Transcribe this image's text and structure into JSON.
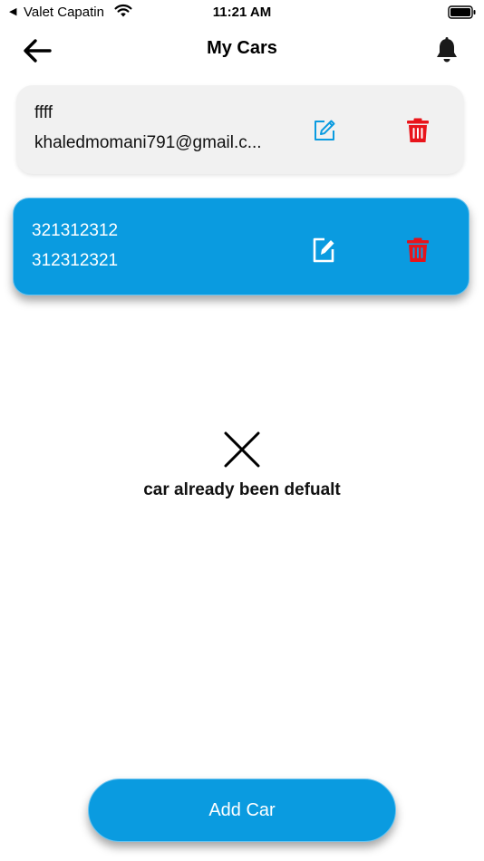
{
  "status_bar": {
    "back_glyph": "◀",
    "carrier": "Valet Capatin",
    "time": "11:21 AM",
    "wifi_icon": "wifi-icon",
    "battery_icon": "battery-icon"
  },
  "nav": {
    "title": "My Cars",
    "back_icon": "arrow-left-icon",
    "bell_icon": "bell-icon"
  },
  "cars": [
    {
      "line1": "ffff",
      "line2": "khaledmomani791@gmail.c...",
      "selected": false,
      "edit_icon": "edit-icon",
      "delete_icon": "trash-icon"
    },
    {
      "line1": "321312312",
      "line2": "312312321",
      "selected": true,
      "edit_icon": "edit-icon",
      "delete_icon": "trash-icon"
    }
  ],
  "message": {
    "icon": "close-icon",
    "text": "car already been defualt"
  },
  "add_button": {
    "label": "Add Car"
  },
  "colors": {
    "accent": "#0a9be0",
    "delete": "#e8141b",
    "card_gray": "#f1f1f1"
  }
}
